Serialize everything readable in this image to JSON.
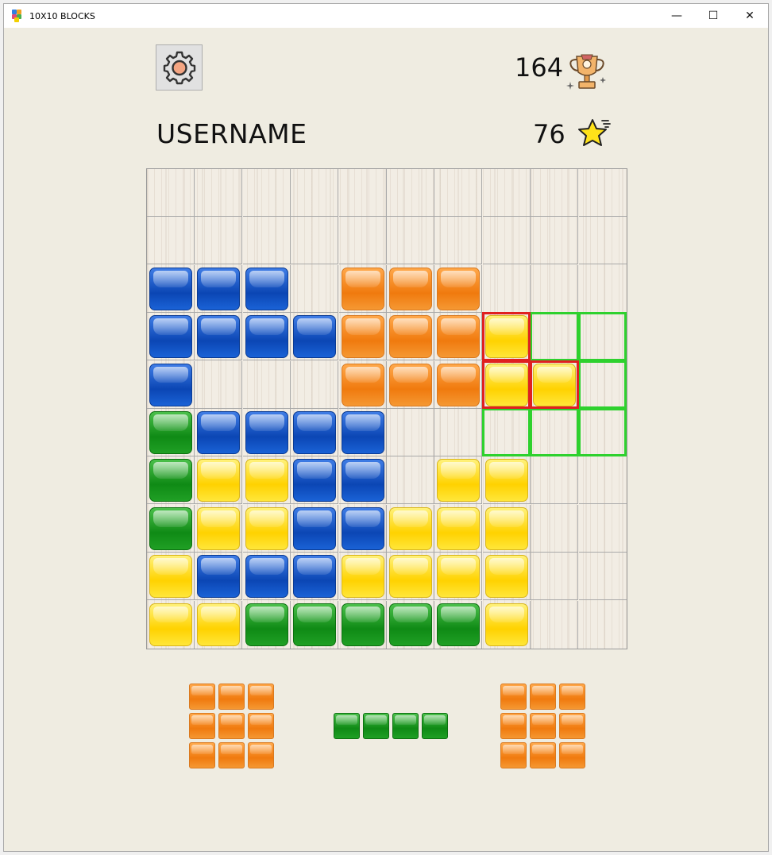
{
  "window": {
    "title": "10X10 BLOCKS",
    "minimize": "—",
    "maximize": "☐",
    "close": "✕"
  },
  "header": {
    "best_score": "164",
    "username": "USERNAME",
    "current_score": "76",
    "settings_icon": "gear-icon",
    "best_icon": "trophy-icon",
    "score_icon": "star-icon"
  },
  "colors": {
    "blue": "#0b46b4",
    "orange": "#f07a0e",
    "yellow": "#ffd200",
    "green": "#0f8a15",
    "highlight_invalid": "#e02020",
    "highlight_valid": "#2ed12e"
  },
  "board": {
    "rows": 10,
    "cols": 10,
    "cells": [
      [
        null,
        null,
        null,
        null,
        null,
        null,
        null,
        null,
        null,
        null
      ],
      [
        null,
        null,
        null,
        null,
        null,
        null,
        null,
        null,
        null,
        null
      ],
      [
        "blue",
        "blue",
        "blue",
        null,
        "orange",
        "orange",
        "orange",
        null,
        null,
        null
      ],
      [
        "blue",
        "blue",
        "blue",
        "blue",
        "orange",
        "orange",
        "orange",
        "yellow",
        null,
        null
      ],
      [
        "blue",
        null,
        null,
        null,
        "orange",
        "orange",
        "orange",
        "yellow",
        "yellow",
        null
      ],
      [
        "green",
        "blue",
        "blue",
        "blue",
        "blue",
        null,
        null,
        null,
        null,
        null
      ],
      [
        "green",
        "yellow",
        "yellow",
        "blue",
        "blue",
        null,
        "yellow",
        "yellow",
        null,
        null
      ],
      [
        "green",
        "yellow",
        "yellow",
        "blue",
        "blue",
        "yellow",
        "yellow",
        "yellow",
        null,
        null
      ],
      [
        "yellow",
        "blue",
        "blue",
        "blue",
        "yellow",
        "yellow",
        "yellow",
        "yellow",
        null,
        null
      ],
      [
        "yellow",
        "yellow",
        "green",
        "green",
        "green",
        "green",
        "green",
        "yellow",
        null,
        null
      ]
    ],
    "placement_preview": {
      "invalid_cells": [
        [
          3,
          7
        ],
        [
          4,
          7
        ],
        [
          4,
          8
        ]
      ],
      "valid_cells": [
        [
          3,
          8
        ],
        [
          3,
          9
        ],
        [
          4,
          9
        ],
        [
          5,
          7
        ],
        [
          5,
          8
        ],
        [
          5,
          9
        ]
      ]
    }
  },
  "tray": {
    "pieces": [
      {
        "color": "orange",
        "shape": [
          [
            1,
            1,
            1
          ],
          [
            1,
            1,
            1
          ],
          [
            1,
            1,
            1
          ]
        ]
      },
      {
        "color": "green",
        "shape": [
          [
            1,
            1,
            1,
            1
          ]
        ]
      },
      {
        "color": "orange",
        "shape": [
          [
            1,
            1,
            1
          ],
          [
            1,
            1,
            1
          ],
          [
            1,
            1,
            1
          ]
        ]
      }
    ]
  }
}
